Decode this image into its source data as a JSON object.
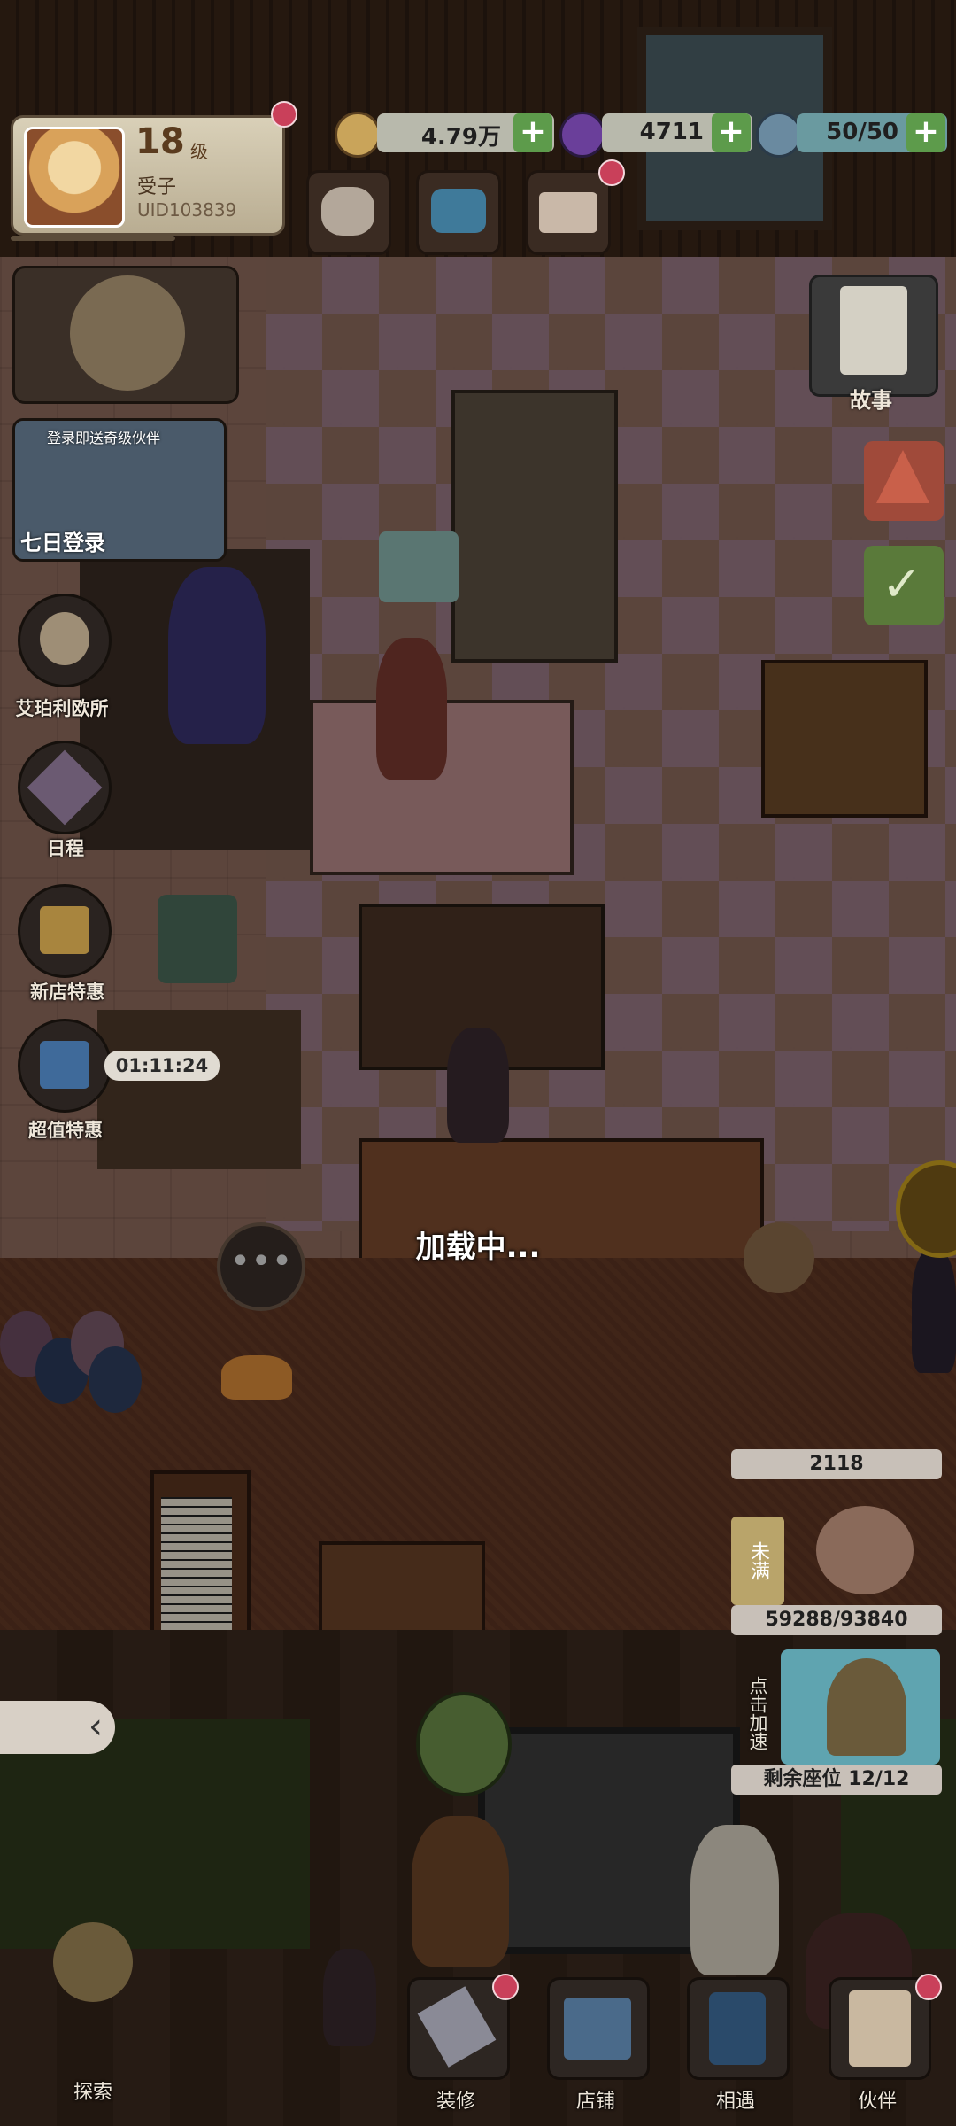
{
  "player": {
    "level": "18",
    "level_unit": "级",
    "name": "受子",
    "uid": "UID103839"
  },
  "resources": [
    {
      "icon": "gold-coin-icon",
      "value": "4.79万"
    },
    {
      "icon": "purple-gem-icon",
      "value": "4711"
    },
    {
      "icon": "energy-bottle-icon",
      "value": "50/50"
    }
  ],
  "left_menu": {
    "login_banner": "登录即送奇级伙伴",
    "login_label": "七日登录",
    "items": [
      {
        "label": "艾珀利欧所",
        "icon": "owl-icon"
      },
      {
        "label": "日程",
        "icon": "schedule-badge-icon"
      },
      {
        "label": "新店特惠",
        "icon": "gift-box-icon"
      },
      {
        "label": "超值特惠",
        "icon": "blue-gift-icon",
        "timer": "01:11:24"
      }
    ]
  },
  "right_menu": {
    "story_label": "故事"
  },
  "status": {
    "loading": "加载中...",
    "customer_count": "2118",
    "not_full": "未满",
    "storage": "59288/93840",
    "speedup": "点击加速",
    "seats": "剩余座位 12/12"
  },
  "bottom_nav": [
    {
      "label": "探索",
      "icon": "pinwheel-icon"
    },
    {
      "label": "装修",
      "icon": "hammer-icon"
    },
    {
      "label": "店铺",
      "icon": "shop-icon"
    },
    {
      "label": "相遇",
      "icon": "phone-booth-icon"
    },
    {
      "label": "伙伴",
      "icon": "cat-card-icon"
    }
  ]
}
